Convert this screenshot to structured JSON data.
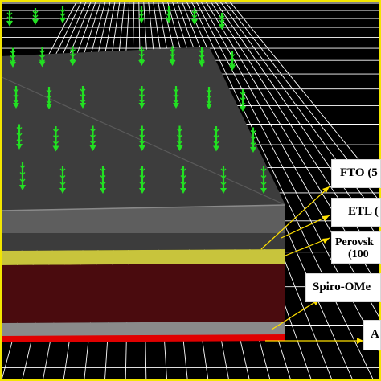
{
  "diagram": {
    "colors": {
      "background": "#000000",
      "grid": "#ffffff",
      "border": "#f2e600",
      "arrow": "#22e022",
      "leader": "#ffe000",
      "layer_fto": "#5e5e5e",
      "layer_etl": "#3c3c3c",
      "layer_perovskite": "#c8c43c",
      "layer_spiro": "#4a0b0e",
      "layer_gold": "#e00000"
    },
    "arrow_icon": "down-arrow-icon",
    "labels": [
      {
        "id": "fto",
        "lines": [
          "FTO (5"
        ]
      },
      {
        "id": "etl",
        "lines": [
          "ETL ("
        ]
      },
      {
        "id": "perovskite",
        "lines": [
          "Perovsk",
          "(100"
        ]
      },
      {
        "id": "spiro",
        "lines": [
          "Spiro-OMe"
        ]
      },
      {
        "id": "gold",
        "lines": [
          "A"
        ]
      }
    ]
  }
}
